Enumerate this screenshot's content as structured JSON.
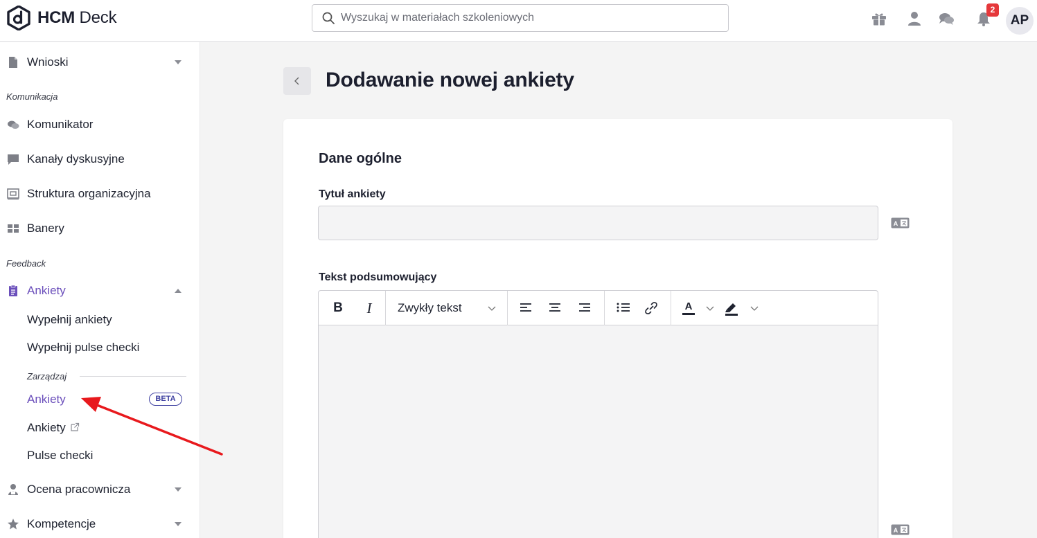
{
  "header": {
    "logo_brand": "HCM",
    "logo_suffix": "Deck",
    "search_placeholder": "Wyszukaj w materiałach szkoleniowych",
    "notifications_count": "2",
    "avatar_initials": "AP"
  },
  "sidebar": {
    "wnioski": "Wnioski",
    "section_komunikacja": "Komunikacja",
    "komunikator": "Komunikator",
    "kanaly": "Kanały dyskusyjne",
    "struktura": "Struktura organizacyjna",
    "banery": "Banery",
    "section_feedback": "Feedback",
    "ankiety": "Ankiety",
    "wypelnij_ankiety": "Wypełnij ankiety",
    "wypelnij_pulse": "Wypełnij pulse checki",
    "zarzadzaj": "Zarządzaj",
    "manage_ankiety": "Ankiety",
    "beta": "BETA",
    "ankiety_external": "Ankiety",
    "pulse_checki": "Pulse checki",
    "ocena": "Ocena pracownicza",
    "kompetencje": "Kompetencje"
  },
  "main": {
    "page_title": "Dodawanie nowej ankiety",
    "section_title": "Dane ogólne",
    "title_label": "Tytuł ankiety",
    "title_value": "",
    "summary_label": "Tekst podsumowujący",
    "toolbar": {
      "bold": "B",
      "italic": "I",
      "block_format": "Zwykły tekst",
      "font_color_letter": "A"
    }
  },
  "colors": {
    "accent": "#6b4fbb",
    "badge": "#e5383b",
    "arrow": "#e8191d"
  }
}
